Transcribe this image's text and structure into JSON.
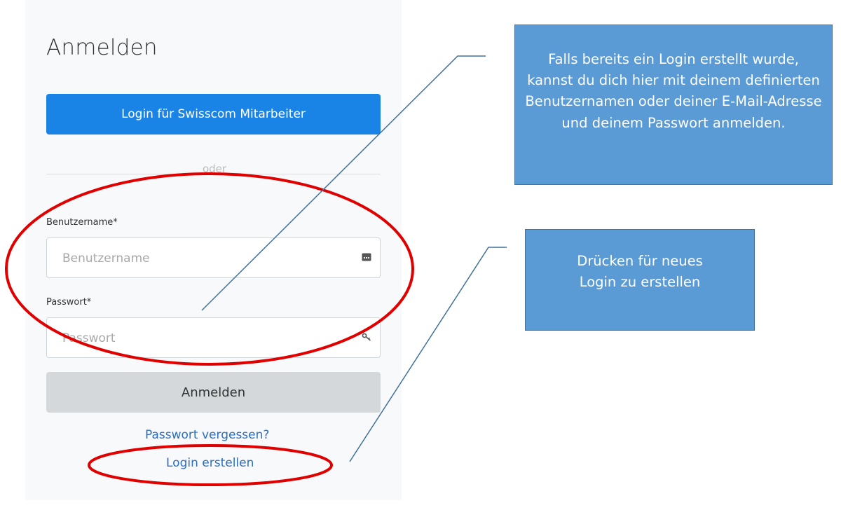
{
  "login_card": {
    "title": "Anmelden",
    "swisscom_button": "Login für Swisscom Mitarbeiter",
    "divider_text": "oder",
    "username": {
      "label": "Benutzername*",
      "placeholder": "Benutzername",
      "icon": "id-card-icon"
    },
    "password": {
      "label": "Passwort*",
      "placeholder": "Passwort",
      "icon": "key-icon"
    },
    "submit_button": "Anmelden",
    "forgot_password_link": "Passwort vergessen?",
    "create_login_link": "Login erstellen"
  },
  "annotations": {
    "callout_login": "Falls bereits ein Login erstellt wurde, kannst du dich hier mit deinem definierten Benutzernamen oder deiner E-Mail-Adresse und deinem Passwort anmelden.",
    "callout_create": "Drücken für neues Login zu erstellen",
    "callout_fill": "#5b9bd5",
    "callout_border": "#41719c",
    "highlight_color": "#e00000",
    "leader_line_color": "#41719c"
  },
  "colors": {
    "primary_button": "#1a84e6",
    "submit_button": "#d5d8db",
    "link": "#2c6ebf",
    "card_background": "#f8f9fa"
  }
}
